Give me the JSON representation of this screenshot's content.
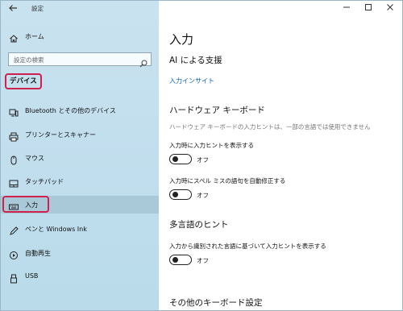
{
  "window": {
    "title": "設定",
    "back_icon": "back-arrow-icon",
    "controls": [
      "minimize-icon",
      "maximize-icon",
      "close-icon"
    ]
  },
  "sidebar": {
    "home_label": "ホーム",
    "search_placeholder": "設定の検索",
    "section_label": "デバイス",
    "items": [
      {
        "label": "Bluetooth とその他のデバイス",
        "icon": "bluetooth-device-icon"
      },
      {
        "label": "プリンターとスキャナー",
        "icon": "printer-icon"
      },
      {
        "label": "マウス",
        "icon": "mouse-icon"
      },
      {
        "label": "タッチパッド",
        "icon": "touchpad-icon"
      },
      {
        "label": "入力",
        "icon": "keyboard-icon",
        "selected": true
      },
      {
        "label": "ペンと Windows Ink",
        "icon": "pen-icon"
      },
      {
        "label": "自動再生",
        "icon": "autoplay-icon"
      },
      {
        "label": "USB",
        "icon": "usb-icon"
      }
    ]
  },
  "main": {
    "title": "入力",
    "ai_heading": "AI による支援",
    "ai_link": "入力インサイト",
    "hw_heading": "ハードウェア キーボード",
    "hw_note": "ハードウェア キーボードの入力ヒントは、一部の言語では使用できません",
    "toggles": [
      {
        "label": "入力時に入力ヒントを表示する",
        "state": "オフ"
      },
      {
        "label": "入力時にスペル ミスの語句を自動修正する",
        "state": "オフ"
      }
    ],
    "multi_heading": "多言語のヒント",
    "multi_toggle": {
      "label": "入力から識別された言語に基づいて入力ヒントを表示する",
      "state": "オフ"
    },
    "other_heading": "その他のキーボード設定"
  },
  "colors": {
    "accent": "#0a64b8",
    "highlight_outline": "#d0214e",
    "sidebar_bg": "#c3dfee",
    "selected_bg": "#a9c8d8"
  }
}
